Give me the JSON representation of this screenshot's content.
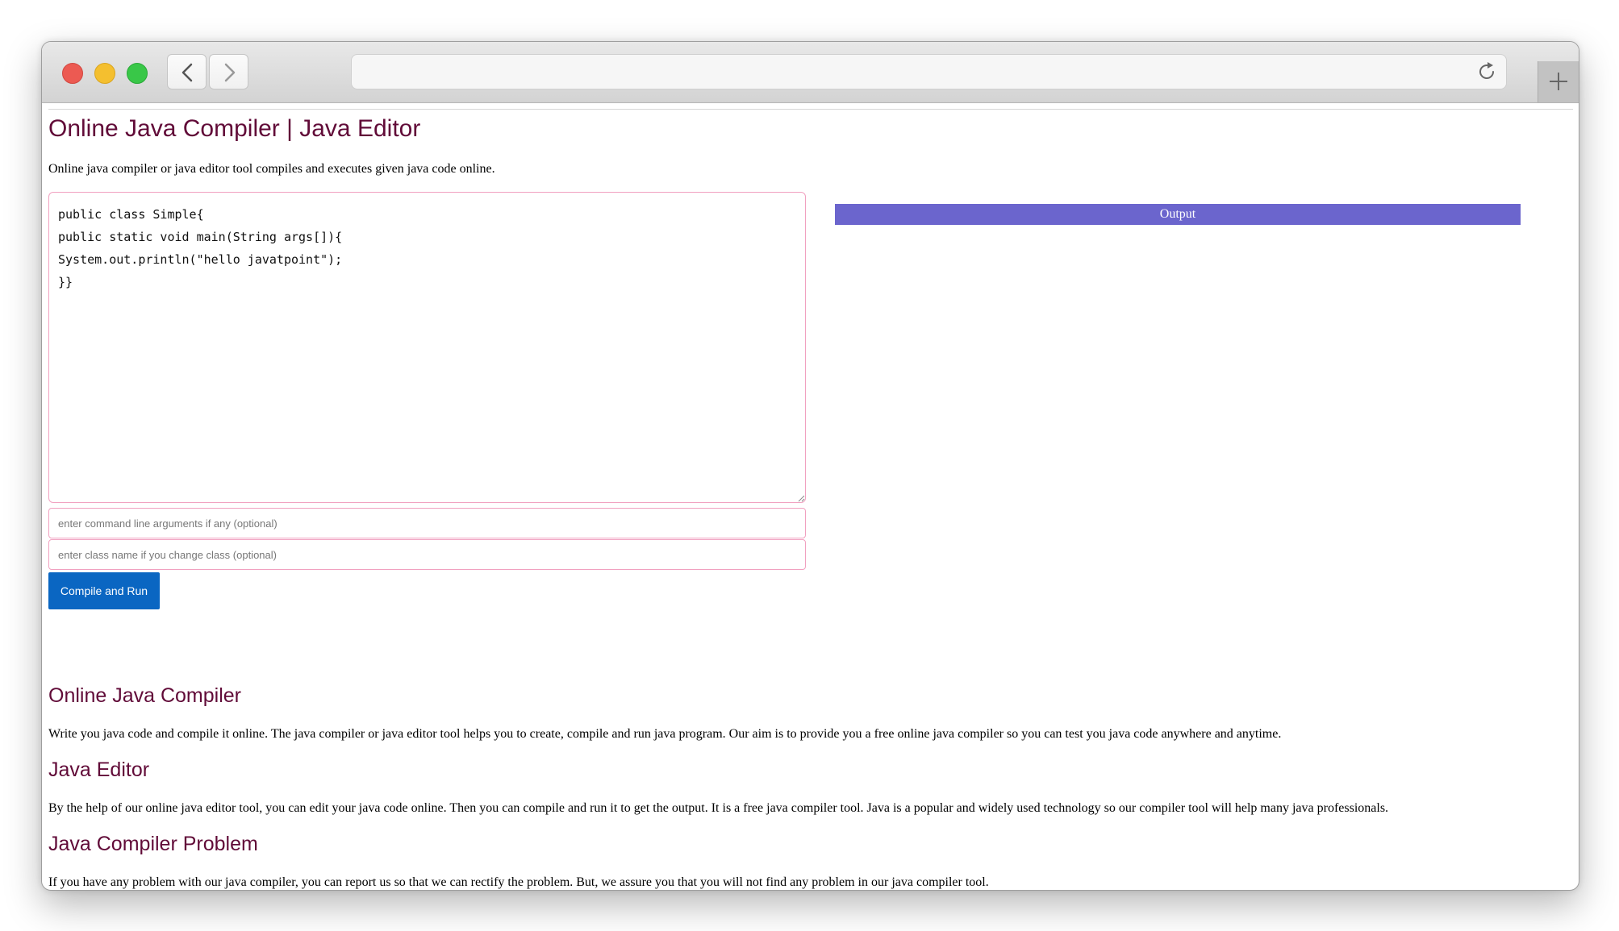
{
  "browser": {
    "address_value": "",
    "icons": [
      "back-icon",
      "forward-icon",
      "reload-icon",
      "plus-icon"
    ]
  },
  "page": {
    "title": "Online Java Compiler | Java Editor",
    "subtitle": "Online java compiler or java editor tool compiles and executes given java code online.",
    "editor_code": "public class Simple{\npublic static void main(String args[]){\nSystem.out.println(\"hello javatpoint\");\n}}",
    "args_placeholder": "enter command line arguments if any (optional)",
    "class_placeholder": "enter class name if you change class (optional)",
    "run_label": "Compile and Run",
    "output_label": "Output"
  },
  "sections": [
    {
      "heading": "Online Java Compiler",
      "text": "Write you java code and compile it online. The java compiler or java editor tool helps you to create, compile and run java program. Our aim is to provide you a free online java compiler so you can test you java code anywhere and anytime."
    },
    {
      "heading": "Java Editor",
      "text": "By the help of our online java editor tool, you can edit your java code online. Then you can compile and run it to get the output. It is a free java compiler tool. Java is a popular and widely used technology so our compiler tool will help many java professionals."
    },
    {
      "heading": "Java Compiler Problem",
      "text": "If you have any problem with our java compiler, you can report us so that we can rectify the problem. But, we assure you that you will not find any problem in our java compiler tool."
    }
  ],
  "colors": {
    "heading": "#610b38",
    "button": "#0a66c2",
    "output_bar": "#6b65cd",
    "field_border": "#f1a1c0"
  }
}
